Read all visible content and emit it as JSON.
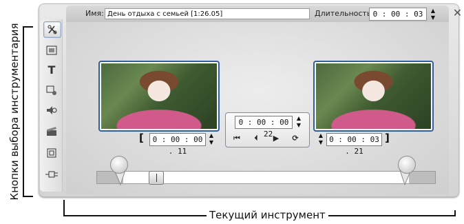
{
  "annotations": {
    "left_label": "Кнопки выбора инструментария",
    "bottom_label": "Текущий инструмент"
  },
  "header": {
    "name_label": "Имя:",
    "name_value": "День отдыха с семьей [1:26.05]",
    "duration_label": "Длительность:",
    "duration_value": "0 : 00 : 03 . 11",
    "close_glyph": "✕"
  },
  "toolbar": {
    "icons": [
      "clip-properties-icon",
      "video-overlay-icon",
      "title-icon",
      "audio-icon",
      "sound-effects-icon",
      "edit-icon",
      "frame-icon",
      "plugin-icon"
    ],
    "title_glyph": "T"
  },
  "trim": {
    "in_timecode": "0 : 00 : 00 . 11",
    "out_timecode": "0 : 00 : 03 . 21",
    "current_timecode": "0 : 00 : 00 . 22",
    "in_bracket": "[",
    "out_bracket": "]"
  },
  "transport": {
    "to_start": "⏮",
    "prev_frame": "⏴",
    "play": "▶",
    "loop": "⟳"
  },
  "colors": {
    "frame_border": "#2f5f9e",
    "panel_background": "#dcdcdc"
  }
}
